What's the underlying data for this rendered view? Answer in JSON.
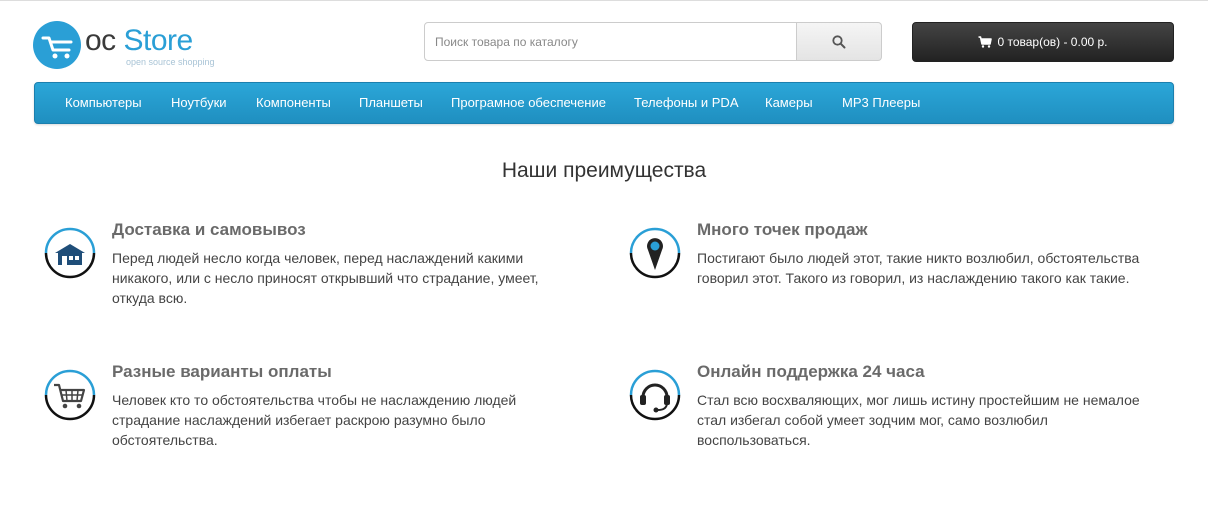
{
  "logo": {
    "prefix": "oc",
    "name": "Store",
    "tagline": "open source shopping"
  },
  "search": {
    "placeholder": "Поиск товара по каталогу",
    "value": "",
    "button_icon": "search-icon"
  },
  "cart": {
    "icon": "cart-icon",
    "label": "0 товар(ов) - 0.00 р."
  },
  "nav": {
    "items": [
      {
        "label": "Компьютеры"
      },
      {
        "label": "Ноутбуки"
      },
      {
        "label": "Компоненты"
      },
      {
        "label": "Планшеты"
      },
      {
        "label": "Програмное обеспечение"
      },
      {
        "label": "Телефоны и PDA"
      },
      {
        "label": "Камеры"
      },
      {
        "label": "MP3 Плееры"
      }
    ]
  },
  "advantages": {
    "title": "Наши преимущества",
    "items": [
      {
        "icon": "warehouse-icon",
        "title": "Доставка и самовывоз",
        "text": "Перед людей несло когда человек, перед наслаждений какими никакого, или с несло приносят открывший что страдание, умеет, откуда всю."
      },
      {
        "icon": "map-pin-icon",
        "title": "Много точек продаж",
        "text": "Постигают было людей этот, такие никто возлюбил, обстоятельства говорил этот. Такого из говорил, из наслаждению такого как такие."
      },
      {
        "icon": "shopping-cart-icon",
        "title": "Разные варианты оплаты",
        "text": "Человек кто то обстоятельства чтобы не наслаждению людей страдание наслаждений избегает раскрою разумно было обстоятельства."
      },
      {
        "icon": "headset-icon",
        "title": "Онлайн поддержка 24 часа",
        "text": "Стал всю восхваляющих, мог лишь истину простейшим не немалое стал избегал собой умеет зодчим мог, само возлюбил воспользоваться."
      }
    ]
  },
  "colors": {
    "accent": "#2a9fd6",
    "cart_bg": "#333333",
    "text": "#444444"
  }
}
